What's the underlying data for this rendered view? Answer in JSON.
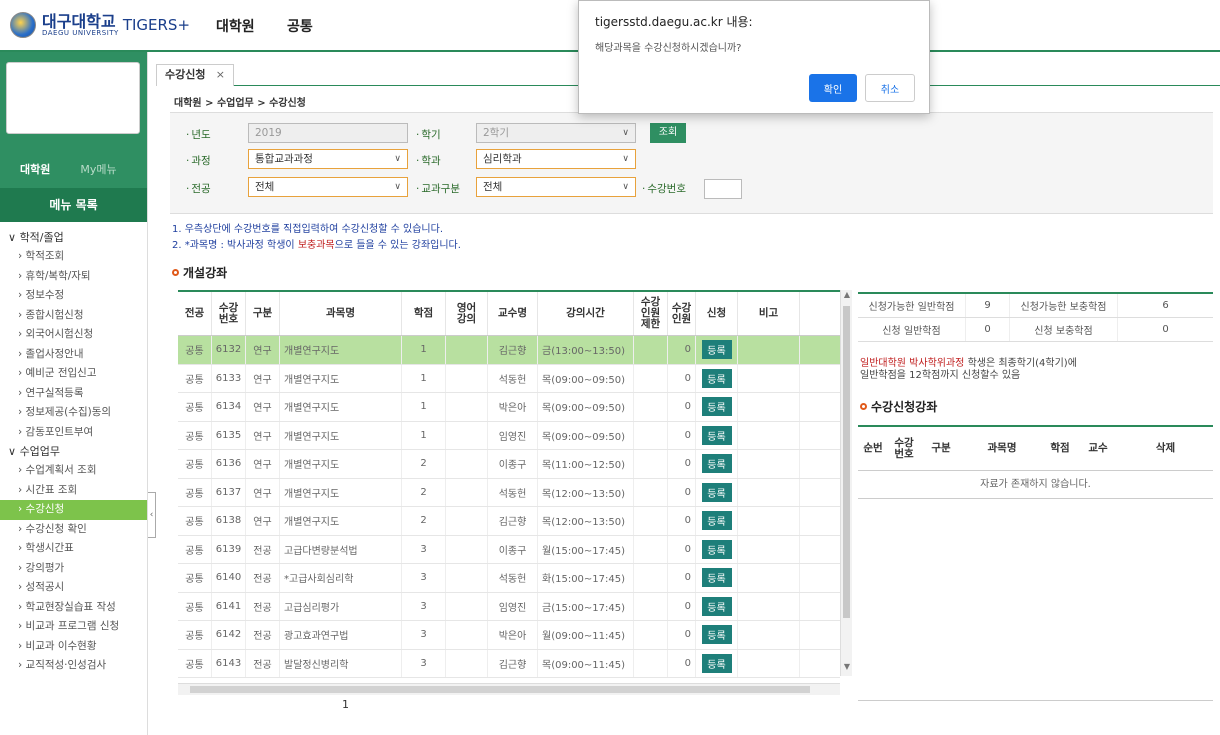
{
  "header": {
    "logo_kr": "대구대학교",
    "logo_en": "DAEGU UNIVERSITY",
    "brand": "TIGERS+",
    "nav": [
      "대학원",
      "공통"
    ]
  },
  "sidebar": {
    "tabs": [
      "대학원",
      "My메뉴"
    ],
    "menu_title": "메뉴 목록",
    "groups": [
      {
        "label": "학적/졸업",
        "items": [
          "학적조회",
          "휴학/복학/자퇴",
          "정보수정",
          "종합시험신청",
          "외국어시험신청",
          "졸업사정안내",
          "예비군 전입신고",
          "연구실적등록",
          "정보제공(수집)동의",
          "감동포인트부여"
        ]
      },
      {
        "label": "수업업무",
        "items": [
          "수업계획서 조회",
          "시간표 조회",
          "수강신청",
          "수강신청 확인",
          "학생시간표",
          "강의평가",
          "성적공시",
          "학교현장실습표 작성",
          "비교과 프로그램 신청",
          "비교과 이수현황",
          "교직적성·인성검사"
        ]
      }
    ],
    "active_item": "수강신청"
  },
  "tabbar": {
    "tab_label": "수강신청",
    "close": "×"
  },
  "breadcrumb": "대학원 > 수업업무 > 수강신청",
  "filter": {
    "year_label": "년도",
    "year_value": "2019",
    "semester_label": "학기",
    "semester_value": "2학기",
    "search_button": "조회",
    "course_label": "과정",
    "course_value": "통합교과과정",
    "dept_label": "학과",
    "dept_value": "심리학과",
    "major_label": "전공",
    "major_value": "전체",
    "category_label": "교과구분",
    "category_value": "전체",
    "classno_label": "수강번호",
    "arrow": "∨"
  },
  "notes": {
    "line1": "1. 우측상단에 수강번호를 직접입력하여 수강신청할 수 있습니다.",
    "line2_a": "2. *과목명 : 박사과정 학생이 ",
    "line2_red": "보충과목",
    "line2_b": "으로 들을 수 있는 강좌입니다."
  },
  "courses": {
    "title": "개설강좌",
    "headers": [
      "전공",
      "수강\n번호",
      "구분",
      "과목명",
      "학점",
      "영어\n강의",
      "교수명",
      "강의시간",
      "수강\n인원\n제한",
      "수강\n인원",
      "신청",
      "비고"
    ],
    "register_label": "등록",
    "rows": [
      {
        "major": "공통",
        "no": "6132",
        "type": "연구",
        "name": "개별연구지도",
        "credit": "1",
        "prof": "김근향",
        "time": "금(13:00~13:50)",
        "count": "0"
      },
      {
        "major": "공통",
        "no": "6133",
        "type": "연구",
        "name": "개별연구지도",
        "credit": "1",
        "prof": "석동헌",
        "time": "목(09:00~09:50)",
        "count": "0"
      },
      {
        "major": "공통",
        "no": "6134",
        "type": "연구",
        "name": "개별연구지도",
        "credit": "1",
        "prof": "박은아",
        "time": "목(09:00~09:50)",
        "count": "0"
      },
      {
        "major": "공통",
        "no": "6135",
        "type": "연구",
        "name": "개별연구지도",
        "credit": "1",
        "prof": "임영진",
        "time": "목(09:00~09:50)",
        "count": "0"
      },
      {
        "major": "공통",
        "no": "6136",
        "type": "연구",
        "name": "개별연구지도",
        "credit": "2",
        "prof": "이종구",
        "time": "목(11:00~12:50)",
        "count": "0"
      },
      {
        "major": "공통",
        "no": "6137",
        "type": "연구",
        "name": "개별연구지도",
        "credit": "2",
        "prof": "석동헌",
        "time": "목(12:00~13:50)",
        "count": "0"
      },
      {
        "major": "공통",
        "no": "6138",
        "type": "연구",
        "name": "개별연구지도",
        "credit": "2",
        "prof": "김근향",
        "time": "목(12:00~13:50)",
        "count": "0"
      },
      {
        "major": "공통",
        "no": "6139",
        "type": "전공",
        "name": "고급다변량분석법",
        "credit": "3",
        "prof": "이종구",
        "time": "월(15:00~17:45)",
        "count": "0"
      },
      {
        "major": "공통",
        "no": "6140",
        "type": "전공",
        "name": "*고급사회심리학",
        "credit": "3",
        "prof": "석동헌",
        "time": "화(15:00~17:45)",
        "count": "0"
      },
      {
        "major": "공통",
        "no": "6141",
        "type": "전공",
        "name": "고급심리평가",
        "credit": "3",
        "prof": "임영진",
        "time": "금(15:00~17:45)",
        "count": "0"
      },
      {
        "major": "공통",
        "no": "6142",
        "type": "전공",
        "name": "광고효과연구법",
        "credit": "3",
        "prof": "박은아",
        "time": "월(09:00~11:45)",
        "count": "0"
      },
      {
        "major": "공통",
        "no": "6143",
        "type": "전공",
        "name": "발달정신병리학",
        "credit": "3",
        "prof": "김근향",
        "time": "목(09:00~11:45)",
        "count": "0"
      }
    ],
    "page_number": "1"
  },
  "credits": {
    "avail_general_label": "신청가능한 일반학점",
    "avail_general_value": "9",
    "avail_supp_label": "신청가능한 보충학점",
    "avail_supp_value": "6",
    "applied_general_label": "신청 일반학점",
    "applied_general_value": "0",
    "applied_supp_label": "신청 보충학점",
    "applied_supp_value": "0"
  },
  "notice": {
    "red": "일반대학원 박사학위과정",
    "rest1": " 학생은 최종학기(4학기)에",
    "line2": "일반학점을 12학점까지 신청할수 있음"
  },
  "applied": {
    "title": "수강신청강좌",
    "headers": [
      "순번",
      "수강\n번호",
      "구분",
      "과목명",
      "학점",
      "교수",
      "삭제"
    ],
    "empty": "자료가 존재하지 않습니다."
  },
  "dialog": {
    "title": "tigersstd.daegu.ac.kr 내용:",
    "message": "해당과목을 수강신청하시겠습니까?",
    "ok": "확인",
    "cancel": "취소"
  },
  "colors": {
    "brand_green": "#2f8f62",
    "register_button": "#1e7f7a",
    "selected_row": "#b8e0a0",
    "dialog_ok": "#1a73e8"
  }
}
